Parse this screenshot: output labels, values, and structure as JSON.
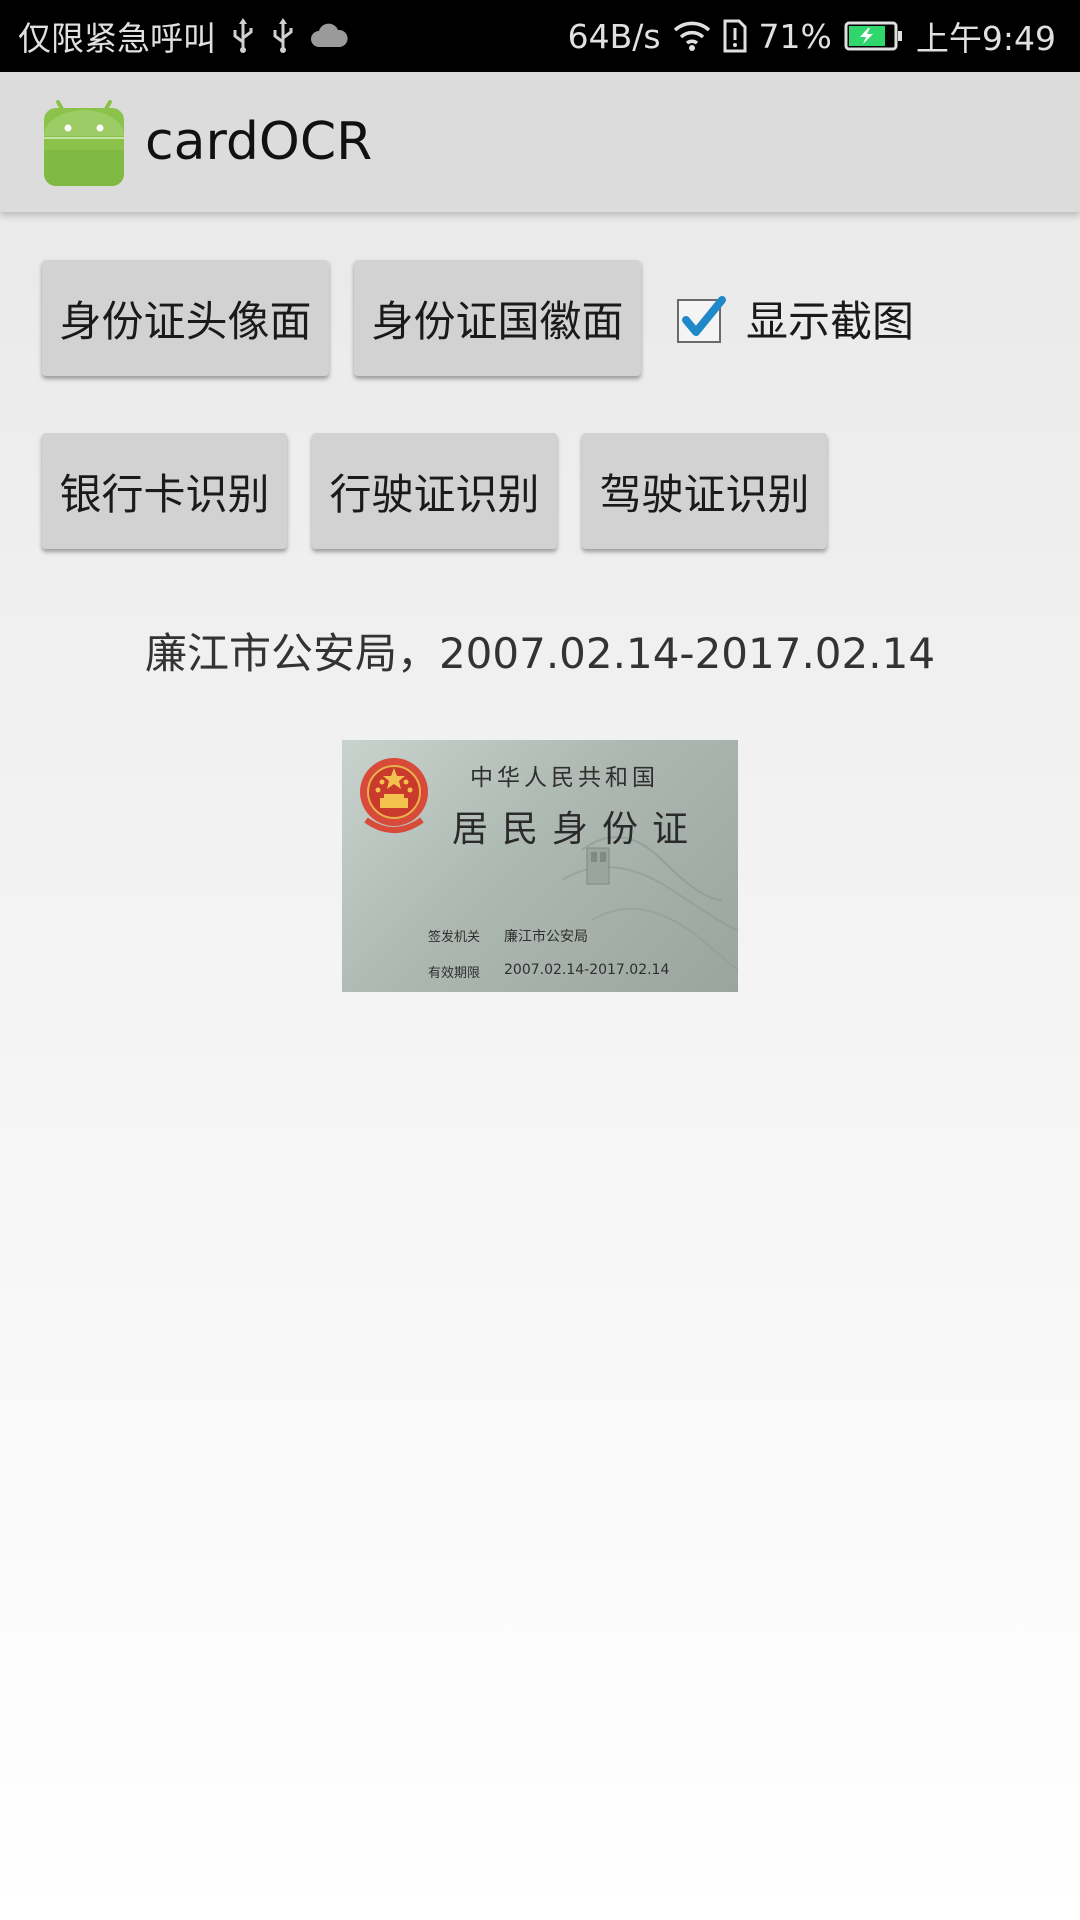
{
  "status_bar": {
    "left_text": "仅限紧急呼叫",
    "speed": "64B/s",
    "battery": "71%",
    "time": "上午9:49",
    "icons": [
      "usb-icon",
      "usb-icon",
      "cloud-icon",
      "wifi-icon",
      "sim-alert-icon",
      "battery-charging-icon"
    ]
  },
  "app_bar": {
    "title": "cardOCR",
    "logo": "android-icon"
  },
  "buttons": {
    "id_front": "身份证头像面",
    "id_back": "身份证国徽面",
    "bank_card": "银行卡识别",
    "vehicle_license": "行驶证识别",
    "driver_license": "驾驶证识别"
  },
  "checkbox": {
    "label": "显示截图",
    "checked": true
  },
  "result": {
    "text": "廉江市公安局，2007.02.14-2017.02.14"
  },
  "card": {
    "country": "中华人民共和国",
    "title": "居民身份证",
    "authority_label": "签发机关",
    "authority_value": "廉江市公安局",
    "validity_label": "有效期限",
    "validity_value": "2007.02.14-2017.02.14"
  },
  "colors": {
    "status_bar_bg": "#000000",
    "app_bar_bg": "#dcdcdc",
    "android_green": "#8bc34a",
    "checkbox_blue": "#1e88c8",
    "button_bg": "#d2d2d2",
    "battery_green": "#2fd66b"
  }
}
